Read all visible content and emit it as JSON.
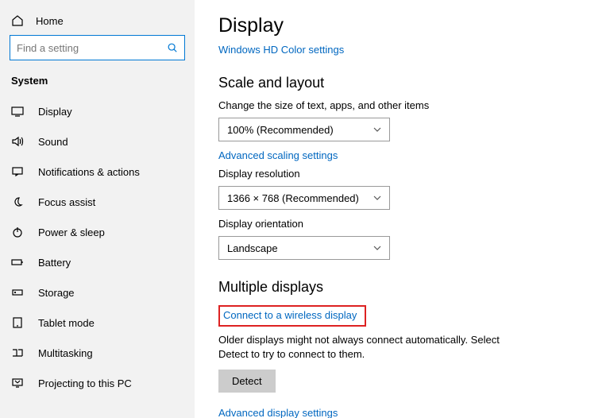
{
  "sidebar": {
    "home": "Home",
    "search_placeholder": "Find a setting",
    "section": "System",
    "items": [
      {
        "label": "Display"
      },
      {
        "label": "Sound"
      },
      {
        "label": "Notifications & actions"
      },
      {
        "label": "Focus assist"
      },
      {
        "label": "Power & sleep"
      },
      {
        "label": "Battery"
      },
      {
        "label": "Storage"
      },
      {
        "label": "Tablet mode"
      },
      {
        "label": "Multitasking"
      },
      {
        "label": "Projecting to this PC"
      }
    ]
  },
  "main": {
    "title": "Display",
    "hd_link": "Windows HD Color settings",
    "scale": {
      "heading": "Scale and layout",
      "size_label": "Change the size of text, apps, and other items",
      "size_value": "100% (Recommended)",
      "adv_link": "Advanced scaling settings",
      "res_label": "Display resolution",
      "res_value": "1366 × 768 (Recommended)",
      "orient_label": "Display orientation",
      "orient_value": "Landscape"
    },
    "multi": {
      "heading": "Multiple displays",
      "connect_link": "Connect to a wireless display",
      "note": "Older displays might not always connect automatically. Select Detect to try to connect to them.",
      "detect": "Detect",
      "adv_link": "Advanced display settings"
    }
  }
}
